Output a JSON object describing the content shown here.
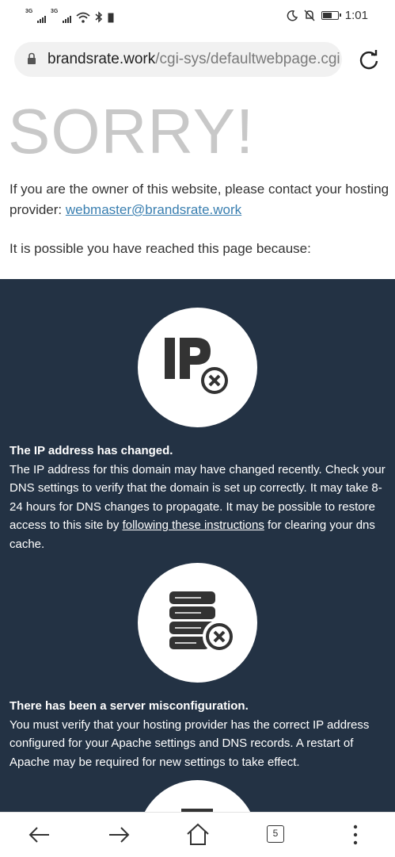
{
  "status_bar": {
    "signal_labels": [
      "3G",
      "3G"
    ],
    "time": "1:01",
    "icons": [
      "wifi-icon",
      "bluetooth-icon",
      "moon-icon",
      "mute-bell-icon",
      "battery-icon"
    ]
  },
  "browser": {
    "url_host": "brandsrate.work",
    "url_path": "/cgi-sys/defaultwebpage.cgi",
    "tabs_count": "5"
  },
  "page": {
    "heading": "SORRY!",
    "owner_text": "If you are the owner of this website, please contact your hosting provider: ",
    "owner_email": "webmaster@brandsrate.work",
    "reason_intro": "It is possible you have reached this page because:",
    "reasons": [
      {
        "icon": "ip-error-icon",
        "title": "The IP address has changed.",
        "text_before": "The IP address for this domain may have changed recently. Check your DNS settings to verify that the domain is set up correctly. It may take 8-24 hours for DNS changes to propagate. It may be possible to restore access to this site by ",
        "link": "following these instructions",
        "text_after": " for clearing your dns cache."
      },
      {
        "icon": "server-error-icon",
        "title": "There has been a server misconfiguration.",
        "text": "You must verify that your hosting provider has the correct IP address configured for your Apache settings and DNS records. A restart of Apache may be required for new settings to take effect."
      }
    ]
  },
  "colors": {
    "dark_section": "#233244",
    "link": "#3a7fb0",
    "heading": "#c8c8c8"
  }
}
